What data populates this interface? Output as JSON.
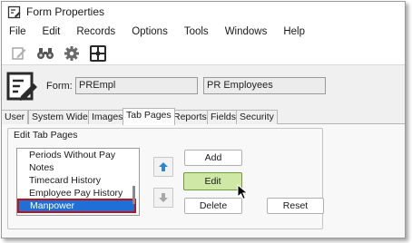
{
  "window": {
    "title": "Form Properties"
  },
  "menu": [
    "File",
    "Edit",
    "Records",
    "Options",
    "Tools",
    "Windows",
    "Help"
  ],
  "toolbar": {
    "icons": [
      "edit-icon",
      "binoculars-icon",
      "gear-icon",
      "layout-grid-icon"
    ]
  },
  "form": {
    "label": "Form:",
    "code": "PREmpl",
    "description": "PR Employees"
  },
  "tabs": [
    "User",
    "System Wide",
    "Images",
    "Tab Pages",
    "Reports",
    "Fields",
    "Security"
  ],
  "active_tab": "Tab Pages",
  "edit_tab_pages": {
    "group_label": "Edit Tab Pages",
    "items": [
      "Periods Without Pay",
      "Notes",
      "Timecard History",
      "Employee Pay History",
      "Manpower"
    ],
    "selected": "Manpower"
  },
  "buttons": {
    "add": "Add",
    "edit": "Edit",
    "delete": "Delete",
    "reset": "Reset"
  },
  "colors": {
    "selection": "#1e6fd6",
    "selection_outline": "#c0101a",
    "edit_button": "#cfe8a6",
    "arrow_blue": "#2f86c9"
  }
}
